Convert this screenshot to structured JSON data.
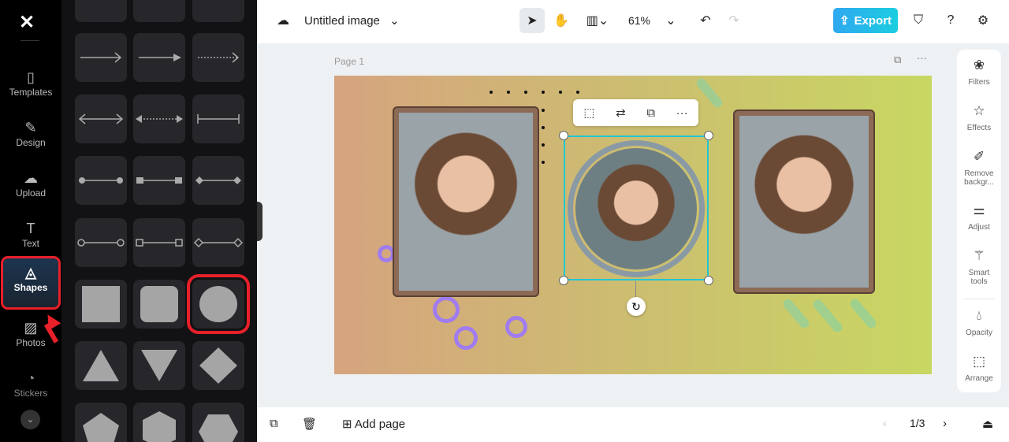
{
  "nav": {
    "items": [
      {
        "label": "Templates",
        "icon": "templates-icon"
      },
      {
        "label": "Design",
        "icon": "design-icon"
      },
      {
        "label": "Upload",
        "icon": "upload-icon"
      },
      {
        "label": "Text",
        "icon": "text-icon"
      },
      {
        "label": "Shapes",
        "icon": "shapes-icon",
        "active": true
      },
      {
        "label": "Photos",
        "icon": "photos-icon"
      },
      {
        "label": "Stickers",
        "icon": "stickers-icon"
      }
    ]
  },
  "header": {
    "title": "Untitled image",
    "zoom": "61%",
    "export": "Export"
  },
  "page": {
    "label": "Page 1"
  },
  "right_tools": [
    {
      "label": "Filters"
    },
    {
      "label": "Effects"
    },
    {
      "label": "Remove backgr..."
    },
    {
      "label": "Adjust"
    },
    {
      "label": "Smart tools"
    },
    {
      "label": "Opacity"
    },
    {
      "label": "Arrange"
    }
  ],
  "footer": {
    "add_page": "Add page",
    "page_counter": "1/3"
  },
  "colors": {
    "accent": "#22c6d0",
    "highlight": "#e8202a",
    "export": "#1ccde0"
  }
}
